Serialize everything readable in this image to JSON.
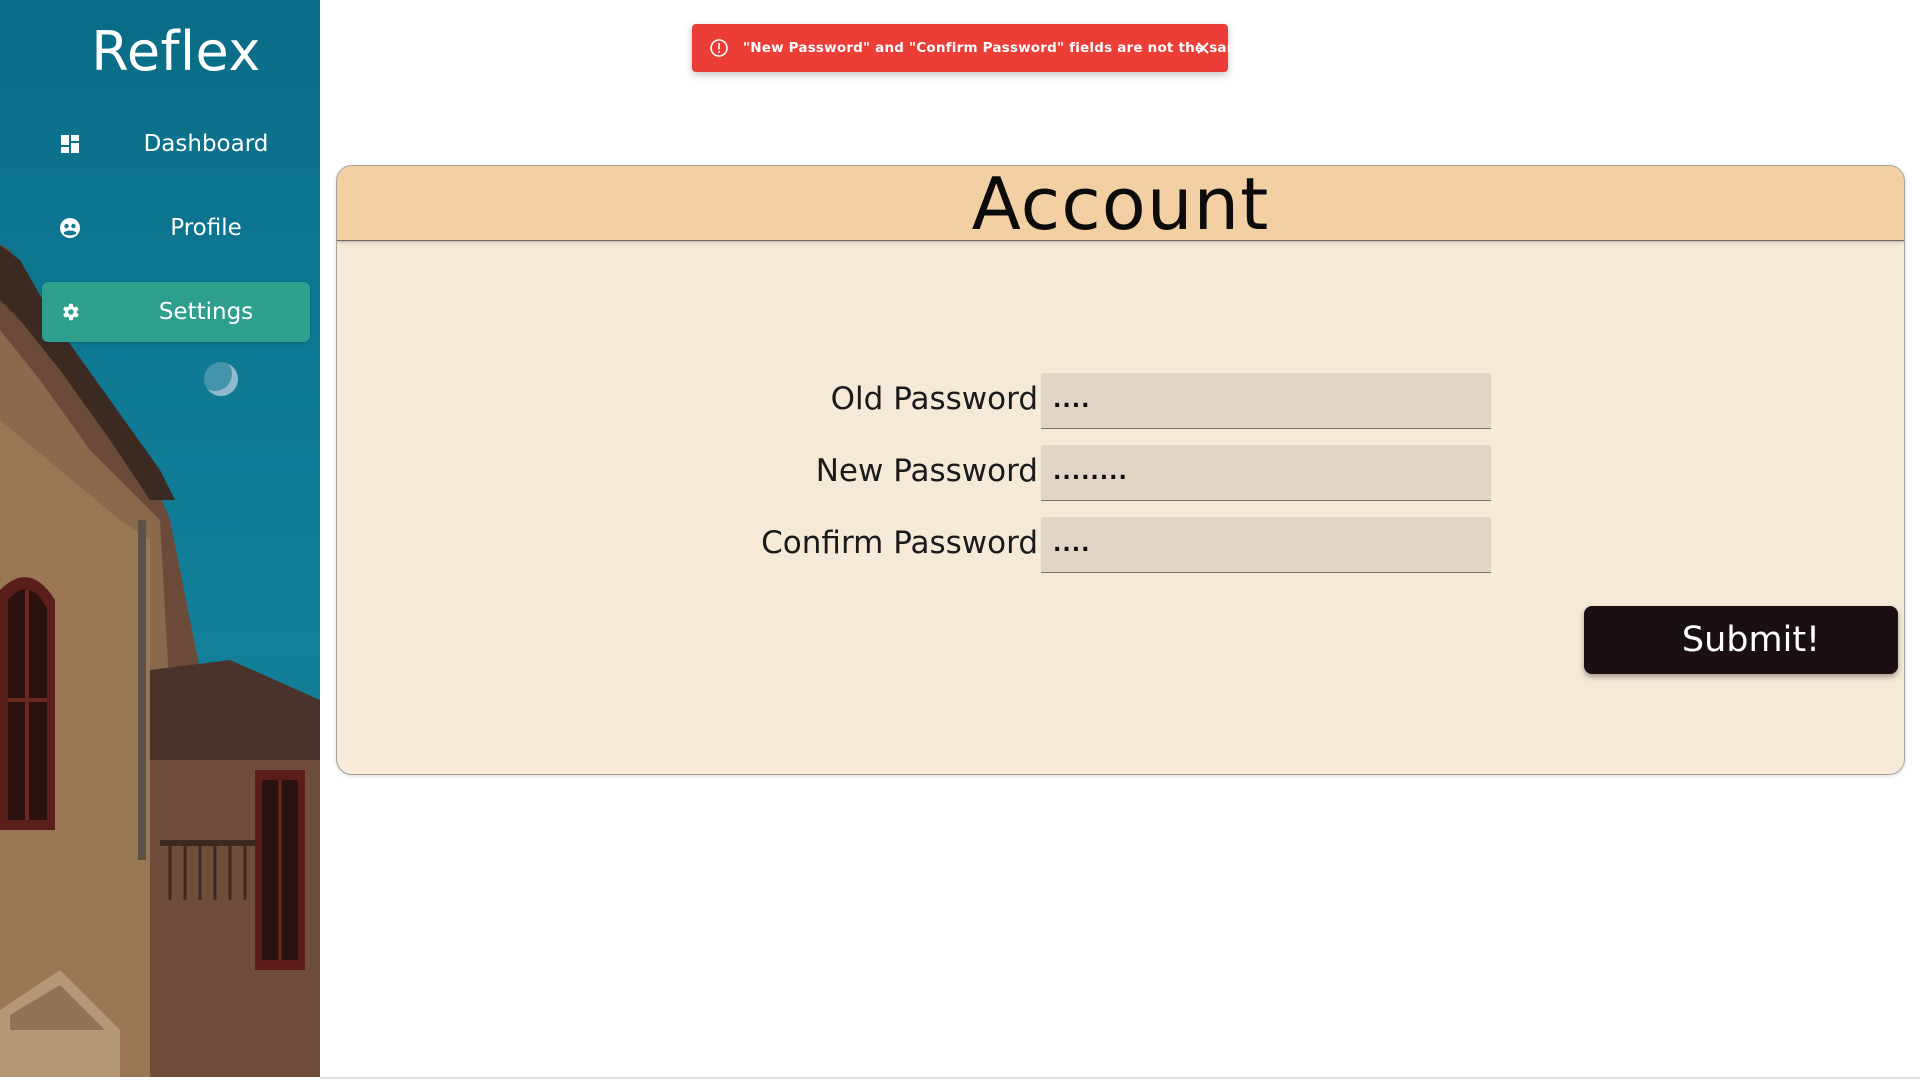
{
  "sidebar": {
    "brand": "Reflex",
    "items": [
      {
        "label": "Dashboard",
        "icon": "dashboard-icon",
        "active": false
      },
      {
        "label": "Profile",
        "icon": "profile-icon",
        "active": false
      },
      {
        "label": "Settings",
        "icon": "gear-icon",
        "active": true
      }
    ],
    "colors": {
      "accent": "#2d9f8c",
      "background": "#0e7893"
    }
  },
  "toast": {
    "message": "\"New Password\" and \"Confirm Password\" fields are not the same",
    "icon": "alert-circle-icon",
    "close_icon": "close-icon",
    "color": "#ec3d36"
  },
  "card": {
    "title": "Account",
    "header_color": "#f3d0a4",
    "body_color": "#f7e9d8",
    "fields": [
      {
        "label": "Old Password",
        "value": "...."
      },
      {
        "label": "New Password",
        "value": "........"
      },
      {
        "label": "Confirm Password",
        "value": "...."
      }
    ],
    "submit_label": "Submit!"
  }
}
